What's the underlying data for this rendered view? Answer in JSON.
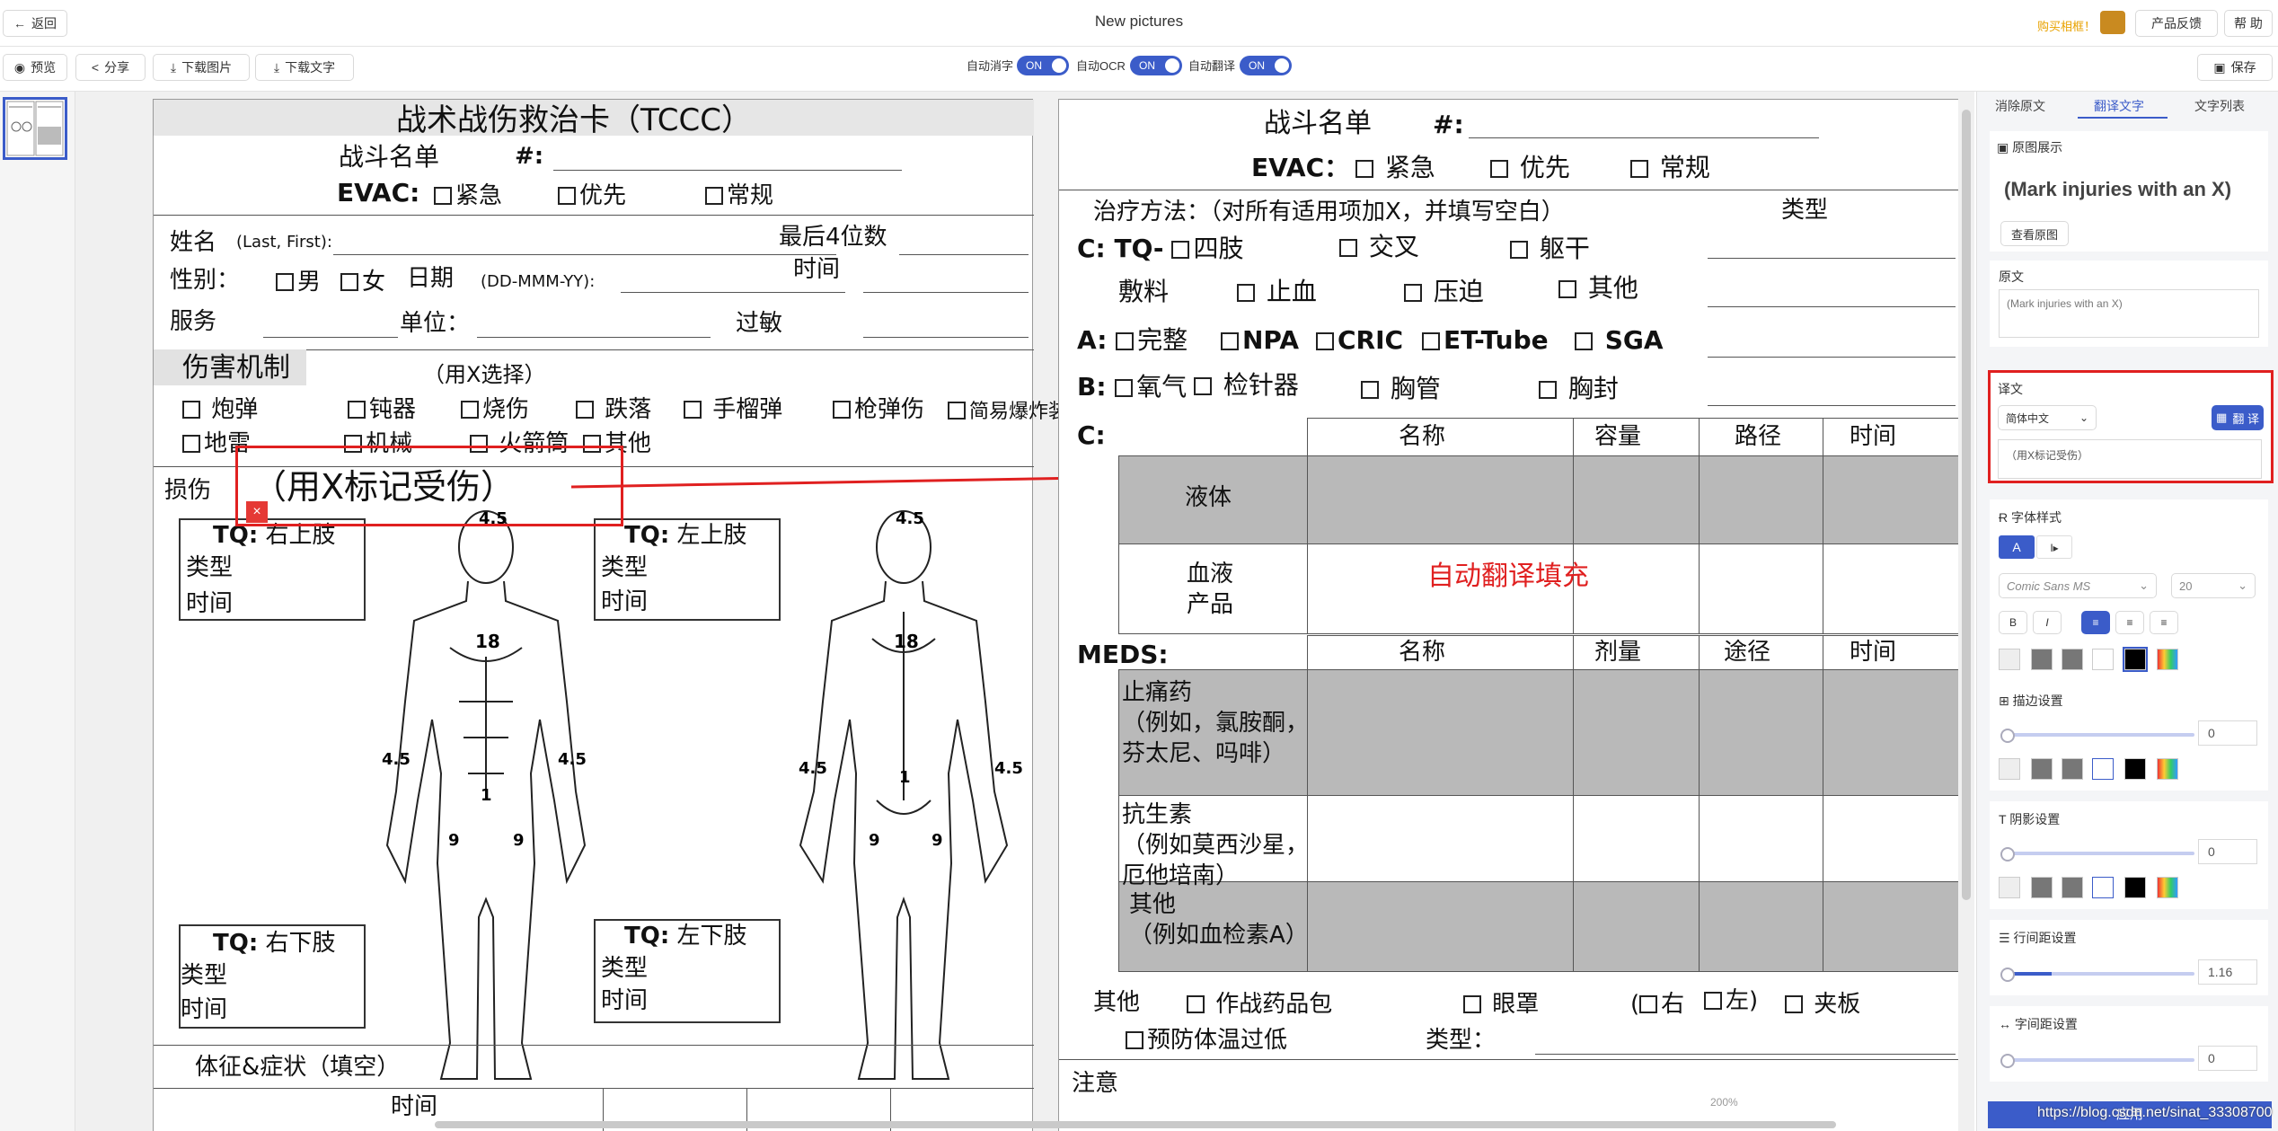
{
  "topbar": {
    "back": "返回",
    "title": "New pictures",
    "promo": "购买相框！",
    "feedback": "产品反馈",
    "help": "帮 助"
  },
  "toolbar": {
    "preview": "预览",
    "share": "分享",
    "download_image": "下载图片",
    "download_text": "下载文字",
    "auto_erase": "自动消字",
    "auto_ocr": "自动OCR",
    "auto_translate": "自动翻译",
    "on": "ON",
    "save": "保存"
  },
  "panel": {
    "tabs": [
      "消除原文",
      "翻译文字",
      "文字列表"
    ],
    "original_image": {
      "title": "原图展示",
      "preview_text": "(Mark injuries with an X)",
      "view_button": "查看原图"
    },
    "source": {
      "title": "原文",
      "value": "(Mark injuries with an X)"
    },
    "translation": {
      "title": "译文",
      "language": "简体中文",
      "translate_button": "翻 译",
      "value": "（用X标记受伤）"
    },
    "font": {
      "title": "字体样式",
      "family": "Comic Sans MS",
      "size": "20",
      "bold": "B",
      "italic": "I"
    },
    "stroke": {
      "title": "描边设置",
      "value": "0"
    },
    "shadow": {
      "title": "阴影设置",
      "value": "0"
    },
    "line_spacing": {
      "title": "行间距设置",
      "value": "1.16"
    },
    "char_spacing": {
      "title": "字间距设置",
      "value": "0"
    },
    "colors": {
      "accent": "#3b5cc9",
      "highlight": "#e02020"
    }
  },
  "canvas": {
    "zoom": "200%",
    "watermark": "https://blog.csdn.net/sinat_33308700",
    "apply": "应用",
    "annotation": "自动翻译填充"
  },
  "card_left": {
    "title": "战术战伤救治卡（TCCC）",
    "roster": "战斗名单",
    "num": "#:",
    "evac": "EVAC:",
    "urgent": "紧急",
    "priority": "优先",
    "routine": "常规",
    "name": "姓名",
    "name_hint": "(Last, First):",
    "last4": "最后4位数",
    "sex": "性别：",
    "male": "男",
    "female": "女",
    "date": "日期",
    "date_hint": "(DD-MMM-YY):",
    "time": "时间",
    "service": "服务",
    "unit": "单位：",
    "allergy": "过敏",
    "mechanism": "伤害机制",
    "select_x": "（用X选择）",
    "artillery": "炮弹",
    "blunt": "钝器",
    "burn": "烧伤",
    "fall": "跌落",
    "grenade": "手榴弹",
    "gsw": "枪弹伤",
    "ied": "简易爆炸装置",
    "landmine": "地雷",
    "mva": "机械",
    "rpg": "火箭筒",
    "other": "其他",
    "injury": "损伤",
    "mark_injuries": "（用X标记受伤）",
    "tq_rua": "右上肢",
    "tq_lua": "左上肢",
    "tq_rll": "右下肢",
    "tq_lll": "左下肢",
    "tq": "TQ:",
    "type": "类型",
    "time2": "时间",
    "pct_head": "4.5",
    "pct_torso": "18",
    "pct_arm": "4.5",
    "pct_groin": "1",
    "pct_leg": "9",
    "signs": "体征&症状（填空）",
    "time3": "时间"
  },
  "card_right": {
    "roster": "战斗名单",
    "num": "#:",
    "evac": "EVAC：",
    "urgent": "紧急",
    "priority": "优先",
    "routine": "常规",
    "treatment": "治疗方法：（对所有适用项加X，并填写空白）",
    "type": "类型",
    "c_tq": "C: TQ-",
    "limb": "四肢",
    "junctional": "交叉",
    "truncal": "躯干",
    "dressing": "敷料",
    "hemostatic": "止血",
    "pressure": "压迫",
    "other": "其他",
    "a": "A:",
    "intact": "完整",
    "npa": "NPA",
    "cric": "CRIC",
    "et": "ET-Tube",
    "sga": "SGA",
    "b": "B:",
    "o2": "氧气",
    "needle": "检针器",
    "chest_tube": "胸管",
    "chest_seal": "胸封",
    "c": "C:",
    "name": "名称",
    "volume": "容量",
    "route": "路径",
    "time": "时间",
    "fluid": "液体",
    "blood": "血液\n产品",
    "meds": "MEDS:",
    "dose": "剂量",
    "route2": "途径",
    "analgesic": "止痛药\n（例如，氯胺酮，\n芬太尼、吗啡）",
    "antibiotic": "抗生素\n（例如莫西沙星，\n厄他培南）",
    "others": "其他\n（例如血检素A）",
    "other_row": "其他",
    "combat_pack": "作战药品包",
    "eye_shield": "眼罩",
    "right": "右",
    "left": "左",
    "splint": "夹板",
    "hypothermia": "预防体温过低",
    "type2": "类型：",
    "notes": "注意"
  }
}
